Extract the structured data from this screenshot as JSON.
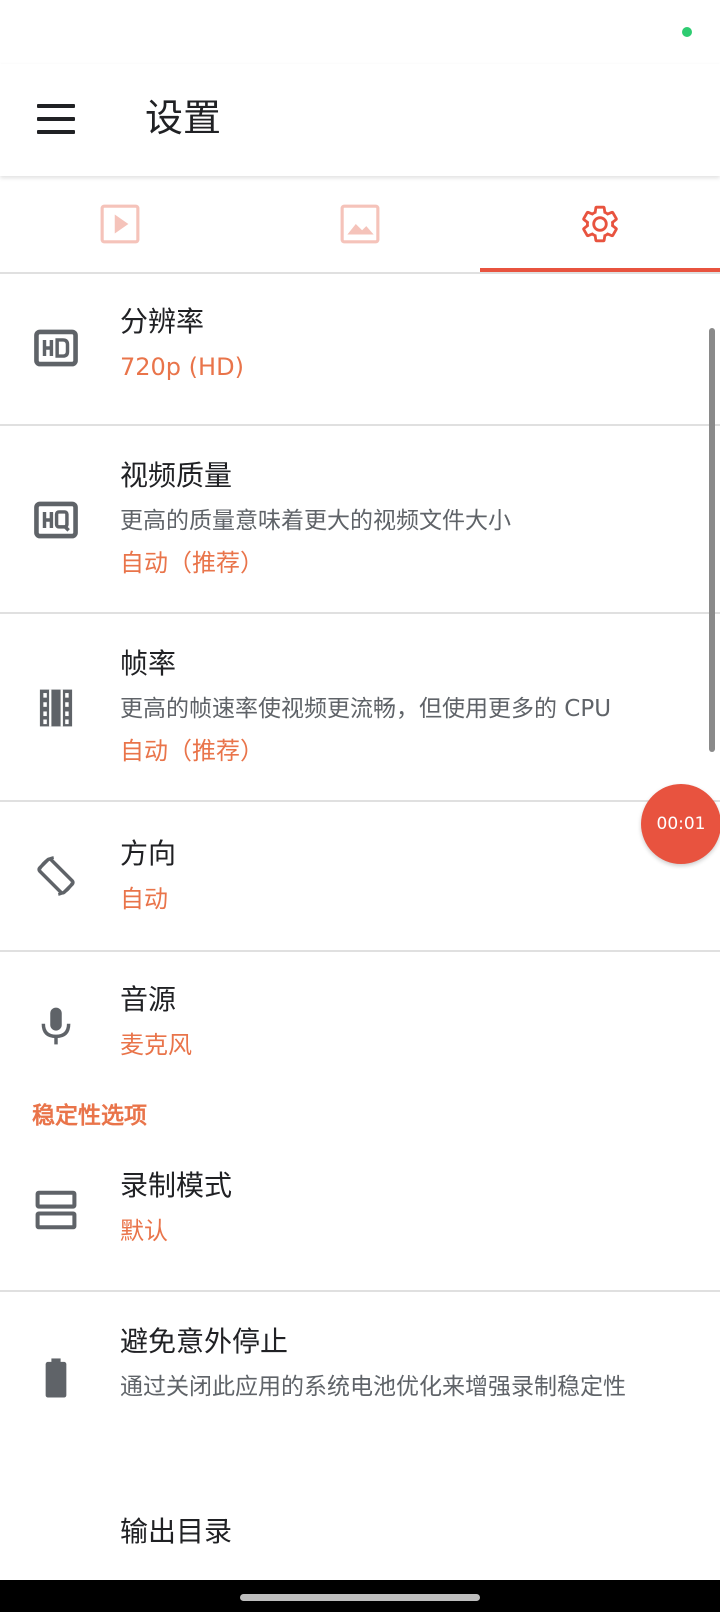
{
  "colors": {
    "accent": "#e8533f",
    "accent_text": "#e9744a",
    "status_dot": "#2ecc71"
  },
  "app_bar": {
    "menu_icon": "menu-icon",
    "title": "设置"
  },
  "tabs": [
    {
      "icon": "video-play-icon",
      "selected": false
    },
    {
      "icon": "image-icon",
      "selected": false
    },
    {
      "icon": "gear-icon",
      "selected": true
    }
  ],
  "settings": {
    "resolution": {
      "icon": "hd-icon",
      "title": "分辨率",
      "value": "720p (HD)"
    },
    "video_quality": {
      "icon": "hq-icon",
      "title": "视频质量",
      "description": "更高的质量意味着更大的视频文件大小",
      "value": "自动（推荐）"
    },
    "frame_rate": {
      "icon": "film-icon",
      "title": "帧率",
      "description": "更高的帧速率使视频更流畅，但使用更多的 CPU",
      "value": "自动（推荐）"
    },
    "orientation": {
      "icon": "screen-rotation-icon",
      "title": "方向",
      "value": "自动"
    },
    "audio_source": {
      "icon": "microphone-icon",
      "title": "音源",
      "value": "麦克风"
    }
  },
  "stability_section": {
    "header": "稳定性选项",
    "recording_mode": {
      "icon": "view-agenda-icon",
      "title": "录制模式",
      "value": "默认"
    },
    "avoid_stop": {
      "icon": "battery-icon",
      "title": "避免意外停止",
      "description": "通过关闭此应用的系统电池优化来增强录制稳定性"
    },
    "output_dir": {
      "title": "输出目录"
    }
  },
  "recording_timer": "00:01"
}
